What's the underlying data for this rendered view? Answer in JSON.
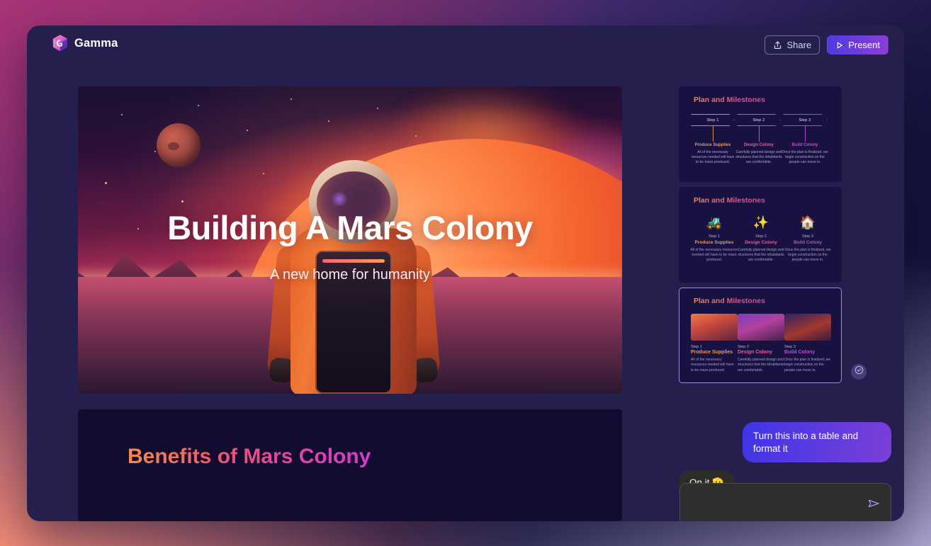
{
  "app": {
    "brand_name": "Gamma",
    "logo_icon": "gamma-cube-logo"
  },
  "topbar": {
    "share_label": "Share",
    "share_icon": "share-upload-icon",
    "present_label": "Present",
    "present_icon": "play-triangle-icon"
  },
  "slides": {
    "hero": {
      "title": "Building A Mars Colony",
      "subtitle": "A new home for humanity",
      "artwork": "mars-landscape-astronaut"
    },
    "benefits": {
      "title": "Benefits of Mars Colony"
    }
  },
  "thumbnails": [
    {
      "title": "Plan and Milestones",
      "layout": "chevron-timeline",
      "selected": false,
      "steps": [
        {
          "chip": "Step 1",
          "name": "Produce Supplies",
          "desc": "All of the necessary resources needed will have to be mass produced."
        },
        {
          "chip": "Step 2",
          "name": "Design Colony",
          "desc": "Carefully planned design and structures that the inhabitants are comfortable."
        },
        {
          "chip": "Step 3",
          "name": "Build Colony",
          "desc": "Once the plan is finalized, we begin construction so the people can move in."
        }
      ]
    },
    {
      "title": "Plan and Milestones",
      "layout": "icon-columns",
      "selected": false,
      "steps": [
        {
          "icon": "forklift-icon",
          "glyph": "🚜",
          "chip": "Step 1",
          "name": "Produce Supplies",
          "desc": "All of the necessary resources needed will have to be mass produced."
        },
        {
          "icon": "magic-wand-icon",
          "glyph": "✨",
          "chip": "Step 2",
          "name": "Design Colony",
          "desc": "Carefully planned design and structures that the inhabitants are comfortable."
        },
        {
          "icon": "house-moon-icon",
          "glyph": "🏠",
          "chip": "Step 3",
          "name": "Build Colony",
          "desc": "Once the plan is finalized, we begin construction so the people can move in."
        }
      ]
    },
    {
      "title": "Plan and Milestones",
      "layout": "image-columns",
      "selected": true,
      "steps": [
        {
          "image": "supply-depot-image",
          "chip": "Step 1",
          "name": "Produce Supplies",
          "desc": "All of the necessary resources needed will have to be mass produced."
        },
        {
          "image": "colony-dome-image",
          "chip": "Step 2",
          "name": "Design Colony",
          "desc": "Carefully planned design and structures that the inhabitants are comfortable."
        },
        {
          "image": "construction-site-image",
          "chip": "Step 3",
          "name": "Build Colony",
          "desc": "Once the plan is finalized, we begin construction so the people can move in."
        }
      ]
    }
  ],
  "selection_badge": {
    "icon": "check-circle-icon"
  },
  "chat": {
    "messages": [
      {
        "role": "user",
        "text": "Turn this into a table and format it"
      },
      {
        "role": "assistant",
        "text": "On it 🫡"
      }
    ],
    "composer": {
      "value": "",
      "placeholder": "",
      "send_icon": "paper-plane-send-icon"
    }
  },
  "colors": {
    "window_bg": "#251f4d",
    "slide_bg": "#120c30",
    "thumb_bg": "#181243",
    "accent_purple": "#7a3fd8",
    "accent_blue": "#3f35e8",
    "selected_border": "#9b8fd6",
    "title_gradient_start": "#f58b4c",
    "title_gradient_end": "#d53ccf",
    "composer_bg": "#302e2c"
  }
}
